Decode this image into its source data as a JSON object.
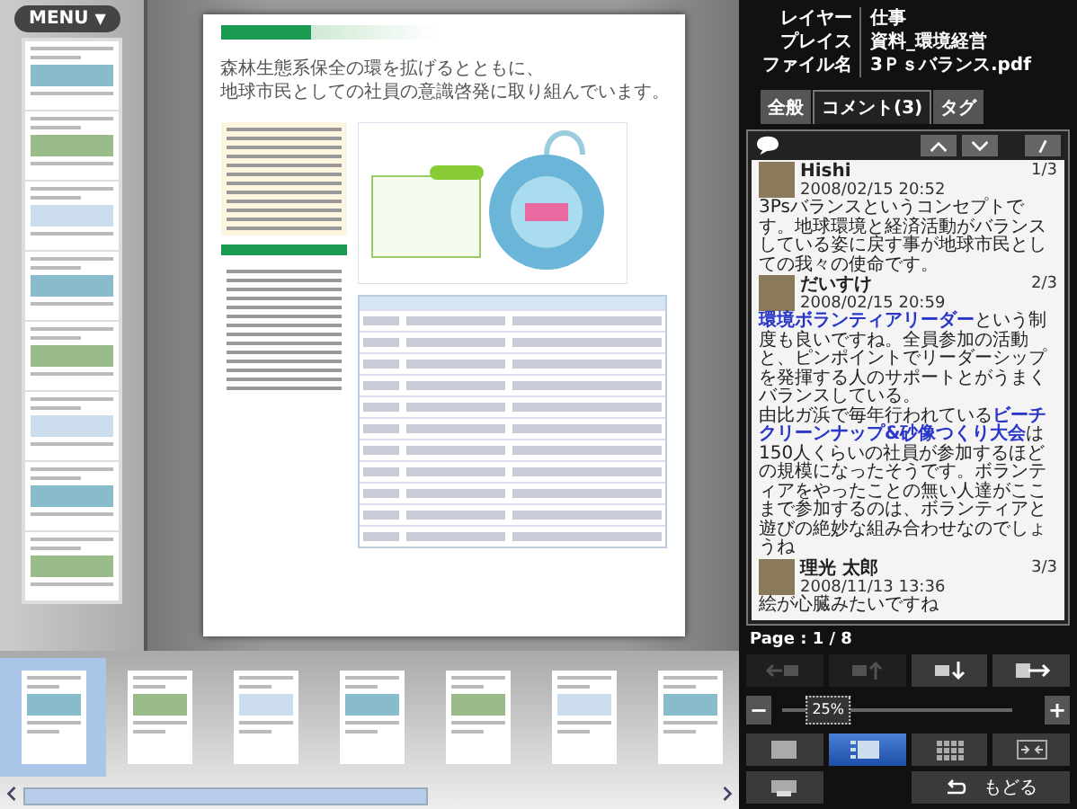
{
  "menu": {
    "label": "MENU",
    "caret": "▼"
  },
  "document": {
    "headline": [
      "森林生態系保全の環を拡げるとともに、",
      "地球市民としての社員の意識啓発に取り組んでいます。"
    ]
  },
  "page_strip": [
    {
      "selected": true
    },
    {
      "selected": false
    },
    {
      "selected": false
    },
    {
      "selected": false
    },
    {
      "selected": false
    },
    {
      "selected": false
    },
    {
      "selected": false
    }
  ],
  "info": [
    {
      "label": "レイヤー",
      "value": "仕事"
    },
    {
      "label": "プレイス",
      "value": "資料_環境経営"
    },
    {
      "label": "ファイル名",
      "value": "3Ｐｓバランス.pdf"
    }
  ],
  "tabs": [
    {
      "label": "全般",
      "selected": false
    },
    {
      "label": "コメント(3)",
      "selected": true
    },
    {
      "label": "タグ",
      "selected": false
    }
  ],
  "comments": [
    {
      "author": "Hishi",
      "index": "1/3",
      "date": "2008/02/15 20:52",
      "paragraphs": [
        "3Psバランスというコンセプトです。地球環境と経済活動がバランスしている姿に戻す事が地球市民としての我々の使命です。"
      ]
    },
    {
      "author": "だいすけ",
      "index": "2/3",
      "date": "2008/02/15 20:59",
      "paragraphs": [
        "**環境ボランティアリーダー**という制度も良いですね。全員参加の活動と、ピンポイントでリーダーシップを発揮する人のサポートとがうまくバランスしている。",
        "由比ガ浜で毎年行われている**ビーチクリーンナップ&砂像つくり大会**は150人くらいの社員が参加するほどの規模になったそうです。ボランティアをやったことの無い人達がここまで参加するのは、ボランティアと遊びの絶妙な組み合わせなのでしょうね"
      ]
    },
    {
      "author": "理光 太郎",
      "index": "3/3",
      "date": "2008/11/13 13:36",
      "paragraphs": [
        "絵が心臓みたいですね"
      ]
    }
  ],
  "page_label": "Page : 1 / 8",
  "tool_buttons": [
    {
      "kind": "prev",
      "disabled": true
    },
    {
      "kind": "up",
      "disabled": true
    },
    {
      "kind": "down",
      "disabled": false
    },
    {
      "kind": "exit",
      "disabled": false
    }
  ],
  "zoom": {
    "minus": "−",
    "plus": "+",
    "label": "25%",
    "level": 0.2
  },
  "view_modes": [
    {
      "kind": "single",
      "selected": false
    },
    {
      "kind": "list",
      "selected": true
    },
    {
      "kind": "grid",
      "selected": false
    },
    {
      "kind": "fit",
      "selected": false
    }
  ],
  "back_button": {
    "label": "もどる"
  }
}
